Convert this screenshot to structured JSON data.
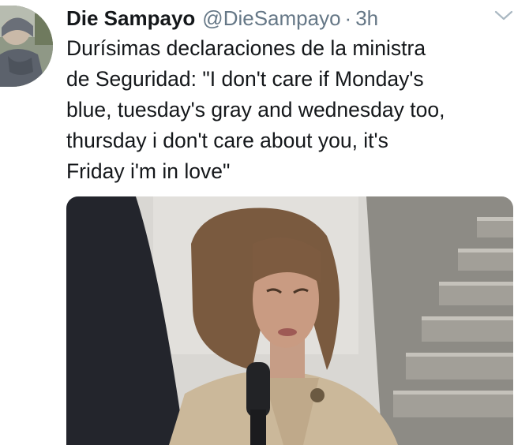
{
  "tweet": {
    "author": {
      "display_name": "Die Sampayo",
      "handle": "@DieSampayo"
    },
    "separator": "·",
    "time": "3h",
    "text": "Durísimas declaraciones de la ministra\nde Seguridad: \"I don't care if Monday's\nblue, tuesday's gray and wednesday too,\nthursday i don't care about you, it's\nFriday i'm in love\""
  },
  "icons": {
    "menu": "chevron-down-icon"
  },
  "colors": {
    "name": "#14171a",
    "secondary": "#657786",
    "chevron": "#aab8c2"
  }
}
